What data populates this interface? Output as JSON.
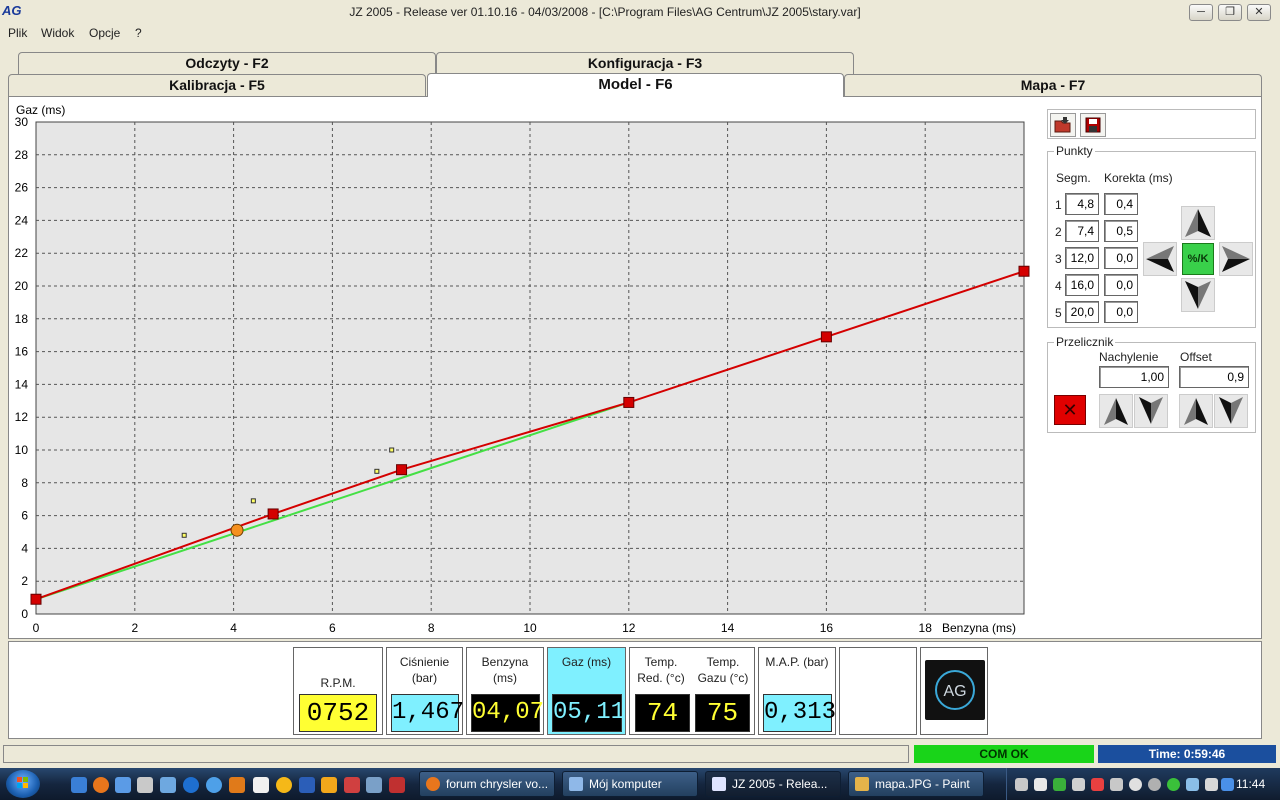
{
  "window": {
    "title": "JZ 2005  - Release  ver 01.10.16 - 04/03/2008 - [C:\\Program Files\\AG Centrum\\JZ 2005\\stary.var]",
    "logo": "AG",
    "min_icon": "minimize-icon",
    "max_icon": "maximize-icon",
    "close_icon": "close-icon"
  },
  "menu": {
    "items": [
      "Plik",
      "Widok",
      "Opcje",
      "?"
    ]
  },
  "tabs": {
    "row1": [
      "Odczyty - F2",
      "Konfiguracja - F3"
    ],
    "row2": [
      "Kalibracja - F5",
      "Model - F6",
      "Mapa - F7"
    ],
    "active": "Model - F6"
  },
  "chart_data": {
    "type": "line",
    "xlabel": "Benzyna (ms)",
    "ylabel": "Gaz (ms)",
    "xlim": [
      0,
      20
    ],
    "ylim": [
      0,
      30
    ],
    "xticks": [
      0,
      2,
      4,
      6,
      8,
      10,
      12,
      14,
      16,
      18
    ],
    "yticks": [
      0,
      2,
      4,
      6,
      8,
      10,
      12,
      14,
      16,
      18,
      20,
      22,
      24,
      26,
      28,
      30
    ],
    "grid": true,
    "series": [
      {
        "style": "green-line",
        "x": [
          0,
          4.8,
          7.4,
          12.0
        ],
        "y": [
          0.9,
          5.7,
          8.3,
          12.9
        ]
      },
      {
        "style": "red-line-with-markers",
        "x": [
          0,
          4.8,
          7.4,
          12.0,
          16.0,
          20.0
        ],
        "y": [
          0.9,
          6.1,
          8.8,
          12.9,
          16.9,
          20.9
        ]
      }
    ],
    "current_point": {
      "x": 4.07,
      "y": 5.11
    },
    "sample_points": [
      {
        "x": 3.0,
        "y": 4.8
      },
      {
        "x": 4.4,
        "y": 6.9
      },
      {
        "x": 6.9,
        "y": 8.7
      },
      {
        "x": 7.2,
        "y": 10.0
      }
    ],
    "colors": {
      "red": "#d40000",
      "green": "#44e044",
      "orange": "#f5901e",
      "plot_bg": "#e6e6e6"
    }
  },
  "toolbar": {
    "open_icon": "folder-open-icon",
    "save_icon": "save-disk-icon"
  },
  "punkty": {
    "title": "Punkty",
    "col_segm": "Segm.",
    "col_korekta": "Korekta (ms)",
    "rows": [
      {
        "n": "1",
        "segm": "4,8",
        "korekta": "0,4"
      },
      {
        "n": "2",
        "segm": "7,4",
        "korekta": "0,5"
      },
      {
        "n": "3",
        "segm": "12,0",
        "korekta": "0,0"
      },
      {
        "n": "4",
        "segm": "16,0",
        "korekta": "0,0"
      },
      {
        "n": "5",
        "segm": "20,0",
        "korekta": "0,0"
      }
    ],
    "center_label": "%/K"
  },
  "przelicznik": {
    "title": "Przelicznik",
    "nachylenie_label": "Nachylenie",
    "offset_label": "Offset",
    "nachylenie": "1,00",
    "offset": "0,9"
  },
  "gauges": {
    "rpm": {
      "label": "R.P.M.",
      "value": "0752"
    },
    "cisnienie": {
      "label1": "Ciśnienie",
      "label2": "(bar)",
      "value": "1,467"
    },
    "benzyna": {
      "label1": "Benzyna",
      "label2": "(ms)",
      "value": "04,07"
    },
    "gaz": {
      "label1": "Gaz (ms)",
      "value": "05,11"
    },
    "temp_red": {
      "label1": "Temp.",
      "label2": "Red. (°c)",
      "value": "74"
    },
    "temp_gazu": {
      "label1": "Temp.",
      "label2": "Gazu (°c)",
      "value": "75"
    },
    "map": {
      "label1": "M.A.P. (bar)",
      "value": "0,313"
    },
    "logo": "AG"
  },
  "status": {
    "com": "COM OK",
    "time": "Time: 0:59:46"
  },
  "taskbar": {
    "tasks": [
      {
        "label": "forum chrysler vo...",
        "icon": "firefox-icon"
      },
      {
        "label": "Mój komputer",
        "icon": "computer-icon"
      },
      {
        "label": "JZ 2005  - Relea...",
        "icon": "ag-app-icon"
      },
      {
        "label": "mapa.JPG - Paint",
        "icon": "paint-icon"
      }
    ],
    "clock": "11:44"
  }
}
